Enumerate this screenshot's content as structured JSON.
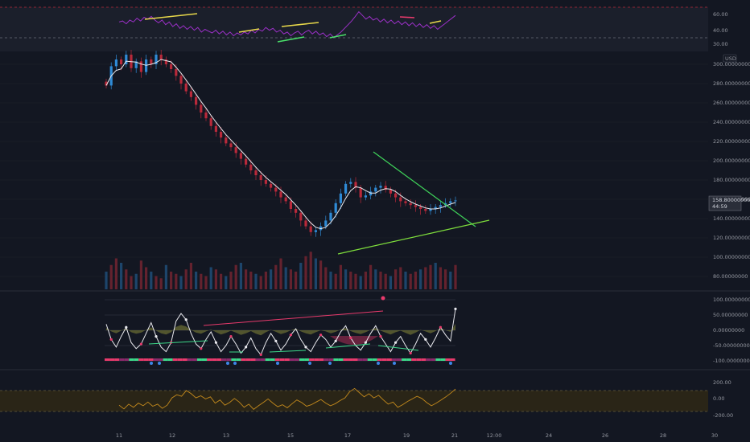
{
  "colors": {
    "background": "#131722",
    "rsi_band": "#1b1f2b",
    "rsi_line": "#9b30c7",
    "bull_candle": "#2f8bd6",
    "bear_candle": "#b9293a",
    "ma_line": "#e9e9ee",
    "triangle_top": "#3fd45a",
    "triangle_bottom": "#7ede3c",
    "osc_pink": "#e83a6c",
    "osc_green": "#3dd98a",
    "osc_yellow": "#c8c844",
    "cci_line": "#c48a1c",
    "cci_band": "#2a2517"
  },
  "chart_data": [
    {
      "type": "line",
      "panel": "rsi",
      "y_ticks": [
        "60.00",
        "40.00",
        "30.00"
      ],
      "levels": [
        70,
        30
      ],
      "series": [
        {
          "values": [
            55,
            56,
            53,
            57,
            55,
            59,
            56,
            60,
            58,
            61,
            57,
            54,
            57,
            52,
            55,
            50,
            53,
            48,
            51,
            47,
            50,
            46,
            49,
            44,
            47,
            45,
            43,
            46,
            42,
            45,
            41,
            44,
            40,
            43,
            41,
            44,
            42,
            46,
            43,
            47,
            45,
            49,
            46,
            48,
            44,
            46,
            42,
            44,
            40,
            43,
            45,
            41,
            44,
            46,
            42,
            45,
            41,
            43,
            39,
            42,
            38,
            41,
            44,
            48,
            52,
            56,
            61,
            66,
            62,
            58,
            61,
            57,
            59,
            55,
            58,
            54,
            57,
            53,
            56,
            52,
            55,
            51,
            54,
            50,
            53,
            49,
            52,
            48,
            51,
            47,
            50,
            53,
            56,
            59,
            62
          ]
        }
      ]
    },
    {
      "type": "candlestick",
      "panel": "price",
      "unit": "USD",
      "y_ticks": [
        "300.00000000",
        "280.00000000",
        "260.00000000",
        "240.00000000",
        "220.00000000",
        "200.00000000",
        "180.00000000",
        "160.00000000",
        "140.00000000",
        "120.00000000",
        "100.00000000",
        "80.00000000"
      ],
      "ylim": [
        80,
        310
      ],
      "current_price": "158.80000000",
      "current_sub": "44:59",
      "close": [
        278,
        298,
        305,
        300,
        310,
        296,
        303,
        292,
        305,
        300,
        310,
        305,
        300,
        295,
        288,
        280,
        272,
        266,
        258,
        250,
        244,
        236,
        230,
        224,
        218,
        214,
        208,
        202,
        196,
        190,
        185,
        180,
        176,
        172,
        168,
        162,
        158,
        150,
        146,
        138,
        132,
        126,
        128,
        132,
        138,
        146,
        156,
        166,
        176,
        178,
        172,
        162,
        164,
        168,
        172,
        174,
        170,
        166,
        162,
        158,
        156,
        154,
        152,
        150,
        148,
        150,
        152,
        154,
        156,
        158,
        158.8
      ],
      "triangle_upper": [
        [
          0.61,
          205
        ],
        [
          0.99,
          144
        ]
      ],
      "triangle_lower": [
        [
          0.46,
          108
        ],
        [
          1.03,
          142
        ]
      ],
      "volume": [
        40,
        55,
        70,
        60,
        45,
        30,
        35,
        65,
        50,
        40,
        30,
        25,
        55,
        40,
        35,
        30,
        45,
        60,
        40,
        35,
        30,
        50,
        45,
        35,
        30,
        40,
        55,
        60,
        45,
        40,
        35,
        30,
        40,
        45,
        55,
        70,
        50,
        45,
        40,
        60,
        75,
        85,
        70,
        65,
        50,
        40,
        35,
        55,
        45,
        40,
        35,
        30,
        40,
        55,
        45,
        40,
        35,
        30,
        45,
        50,
        40,
        35,
        40,
        45,
        50,
        55,
        60,
        50,
        45,
        40,
        55
      ]
    },
    {
      "type": "line",
      "panel": "oscillator",
      "y_ticks": [
        "100.00000000",
        "50.00000000",
        "0.00000000",
        "-50.00000000",
        "-100.00000000"
      ],
      "ylim": [
        -110,
        110
      ],
      "series": [
        {
          "values": [
            20,
            -30,
            -55,
            -20,
            10,
            -40,
            -60,
            -45,
            -10,
            25,
            -20,
            -55,
            -70,
            -40,
            30,
            55,
            35,
            -10,
            -45,
            -60,
            -30,
            -5,
            -40,
            -70,
            -50,
            -20,
            -45,
            -75,
            -55,
            -25,
            -60,
            -80,
            -40,
            -10,
            -35,
            -65,
            -45,
            -15,
            5,
            -30,
            -55,
            -70,
            -40,
            -15,
            -30,
            -55,
            -35,
            -5,
            15,
            -25,
            -50,
            -65,
            -40,
            -10,
            15,
            -20,
            -45,
            -70,
            -40,
            -20,
            -50,
            -75,
            -45,
            -10,
            -30,
            -55,
            -25,
            10,
            -15,
            -35,
            70
          ]
        }
      ]
    },
    {
      "type": "line",
      "panel": "cci",
      "y_ticks": [
        "200.00",
        "0.00",
        "-200.00"
      ],
      "ylim": [
        -300,
        300
      ],
      "series": [
        {
          "values": [
            -80,
            -150,
            -60,
            -120,
            -40,
            -90,
            -20,
            -100,
            -60,
            -140,
            -80,
            60,
            120,
            90,
            200,
            140,
            60,
            100,
            40,
            80,
            -40,
            20,
            -80,
            -30,
            50,
            -20,
            -120,
            -60,
            -160,
            -90,
            -30,
            40,
            -40,
            -110,
            -70,
            -130,
            -50,
            20,
            -30,
            -100,
            -70,
            -20,
            30,
            -40,
            -90,
            -50,
            10,
            60,
            180,
            240,
            160,
            80,
            140,
            60,
            110,
            20,
            -60,
            -20,
            -120,
            -70,
            -10,
            40,
            90,
            50,
            -30,
            -90,
            -40,
            20,
            80,
            150,
            230
          ]
        }
      ]
    }
  ],
  "x_ticks": [
    "11",
    "12",
    "13",
    "15",
    "17",
    "19",
    "21",
    "12:00",
    "24",
    "26",
    "28",
    "30"
  ]
}
